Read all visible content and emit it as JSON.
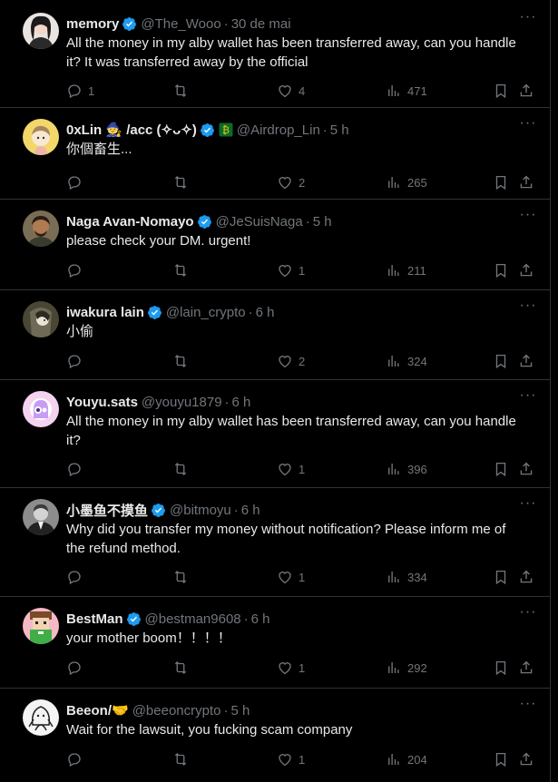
{
  "tweets": [
    {
      "name": "memory",
      "handle": "@The_Wooo",
      "time": "30 de mai",
      "text": "All the money in my alby wallet has been transferred away, can you handle it? It was transferred away by the official",
      "replies": "1",
      "retweets": "",
      "likes": "4",
      "views": "471",
      "verified": true
    },
    {
      "name": "0xLin 🧙 /acc (✧ᴗ✧)",
      "handle": "@Airdrop_Lin",
      "time": "5 h",
      "text": "你個畜生...",
      "replies": "",
      "retweets": "",
      "likes": "2",
      "views": "265",
      "verified": true
    },
    {
      "name": "Naga Avan-Nomayo",
      "handle": "@JeSuisNaga",
      "time": "5 h",
      "text": "please check your DM. urgent!",
      "replies": "",
      "retweets": "",
      "likes": "1",
      "views": "211",
      "verified": true
    },
    {
      "name": "iwakura lain",
      "handle": "@lain_crypto",
      "time": "6 h",
      "text": "小偷",
      "replies": "",
      "retweets": "",
      "likes": "2",
      "views": "324",
      "verified": true
    },
    {
      "name": "Youyu.sats",
      "handle": "@youyu1879",
      "time": "6 h",
      "text": "All the money in my alby wallet has been transferred away, can you handle it?",
      "replies": "",
      "retweets": "",
      "likes": "1",
      "views": "396",
      "verified": false
    },
    {
      "name": "小墨鱼不摸鱼",
      "handle": "@bitmoyu",
      "time": "6 h",
      "text": "Why did you transfer my money without notification? Please inform me of the refund method.",
      "replies": "",
      "retweets": "",
      "likes": "1",
      "views": "334",
      "verified": true
    },
    {
      "name": "BestMan",
      "handle": "@bestman9608",
      "time": "6 h",
      "text": "your  mother boom！！！！",
      "replies": "",
      "retweets": "",
      "likes": "1",
      "views": "292",
      "verified": true
    },
    {
      "name": "Beeon/🤝",
      "handle": "@beeoncrypto",
      "time": "5 h",
      "text": "Wait for the lawsuit, you fucking scam company",
      "replies": "",
      "retweets": "",
      "likes": "1",
      "views": "204",
      "verified": false
    }
  ],
  "separator": "·",
  "icons": {
    "more": "more-horizontal-icon",
    "reply": "reply-icon",
    "retweet": "retweet-icon",
    "like": "like-icon",
    "views": "views-icon",
    "bookmark": "bookmark-icon",
    "share": "share-icon",
    "verified": "verified-badge-icon"
  },
  "colors": {
    "background": "#000000",
    "text": "#e7e9ea",
    "muted": "#71767b",
    "border": "#2f3336",
    "verified": "#1d9bf0"
  }
}
